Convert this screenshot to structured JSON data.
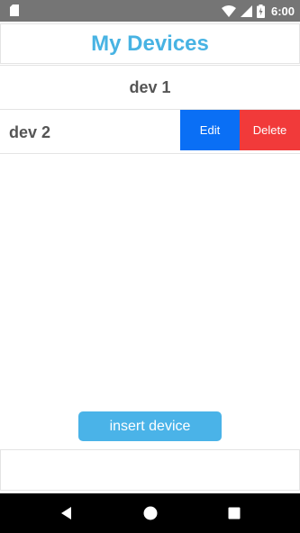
{
  "status_bar": {
    "time": "6:00",
    "battery_icon": "battery-charging-icon",
    "wifi_icon": "wifi-icon",
    "signal_icon": "cell-signal-icon",
    "sd_icon": "sd-card-icon"
  },
  "header": {
    "title": "My Devices"
  },
  "devices": [
    {
      "label": "dev 1"
    },
    {
      "label": "dev 2",
      "edit_label": "Edit",
      "delete_label": "Delete"
    }
  ],
  "insert_button": {
    "label": "insert device"
  },
  "nav_bar": {
    "back_icon": "back-triangle-icon",
    "home_icon": "home-circle-icon",
    "recents_icon": "recents-square-icon"
  },
  "colors": {
    "title": "#48b3e3",
    "edit": "#0a6ff5",
    "delete": "#f13a3a",
    "insert": "#4ab3e8",
    "status_bar": "#757575"
  }
}
